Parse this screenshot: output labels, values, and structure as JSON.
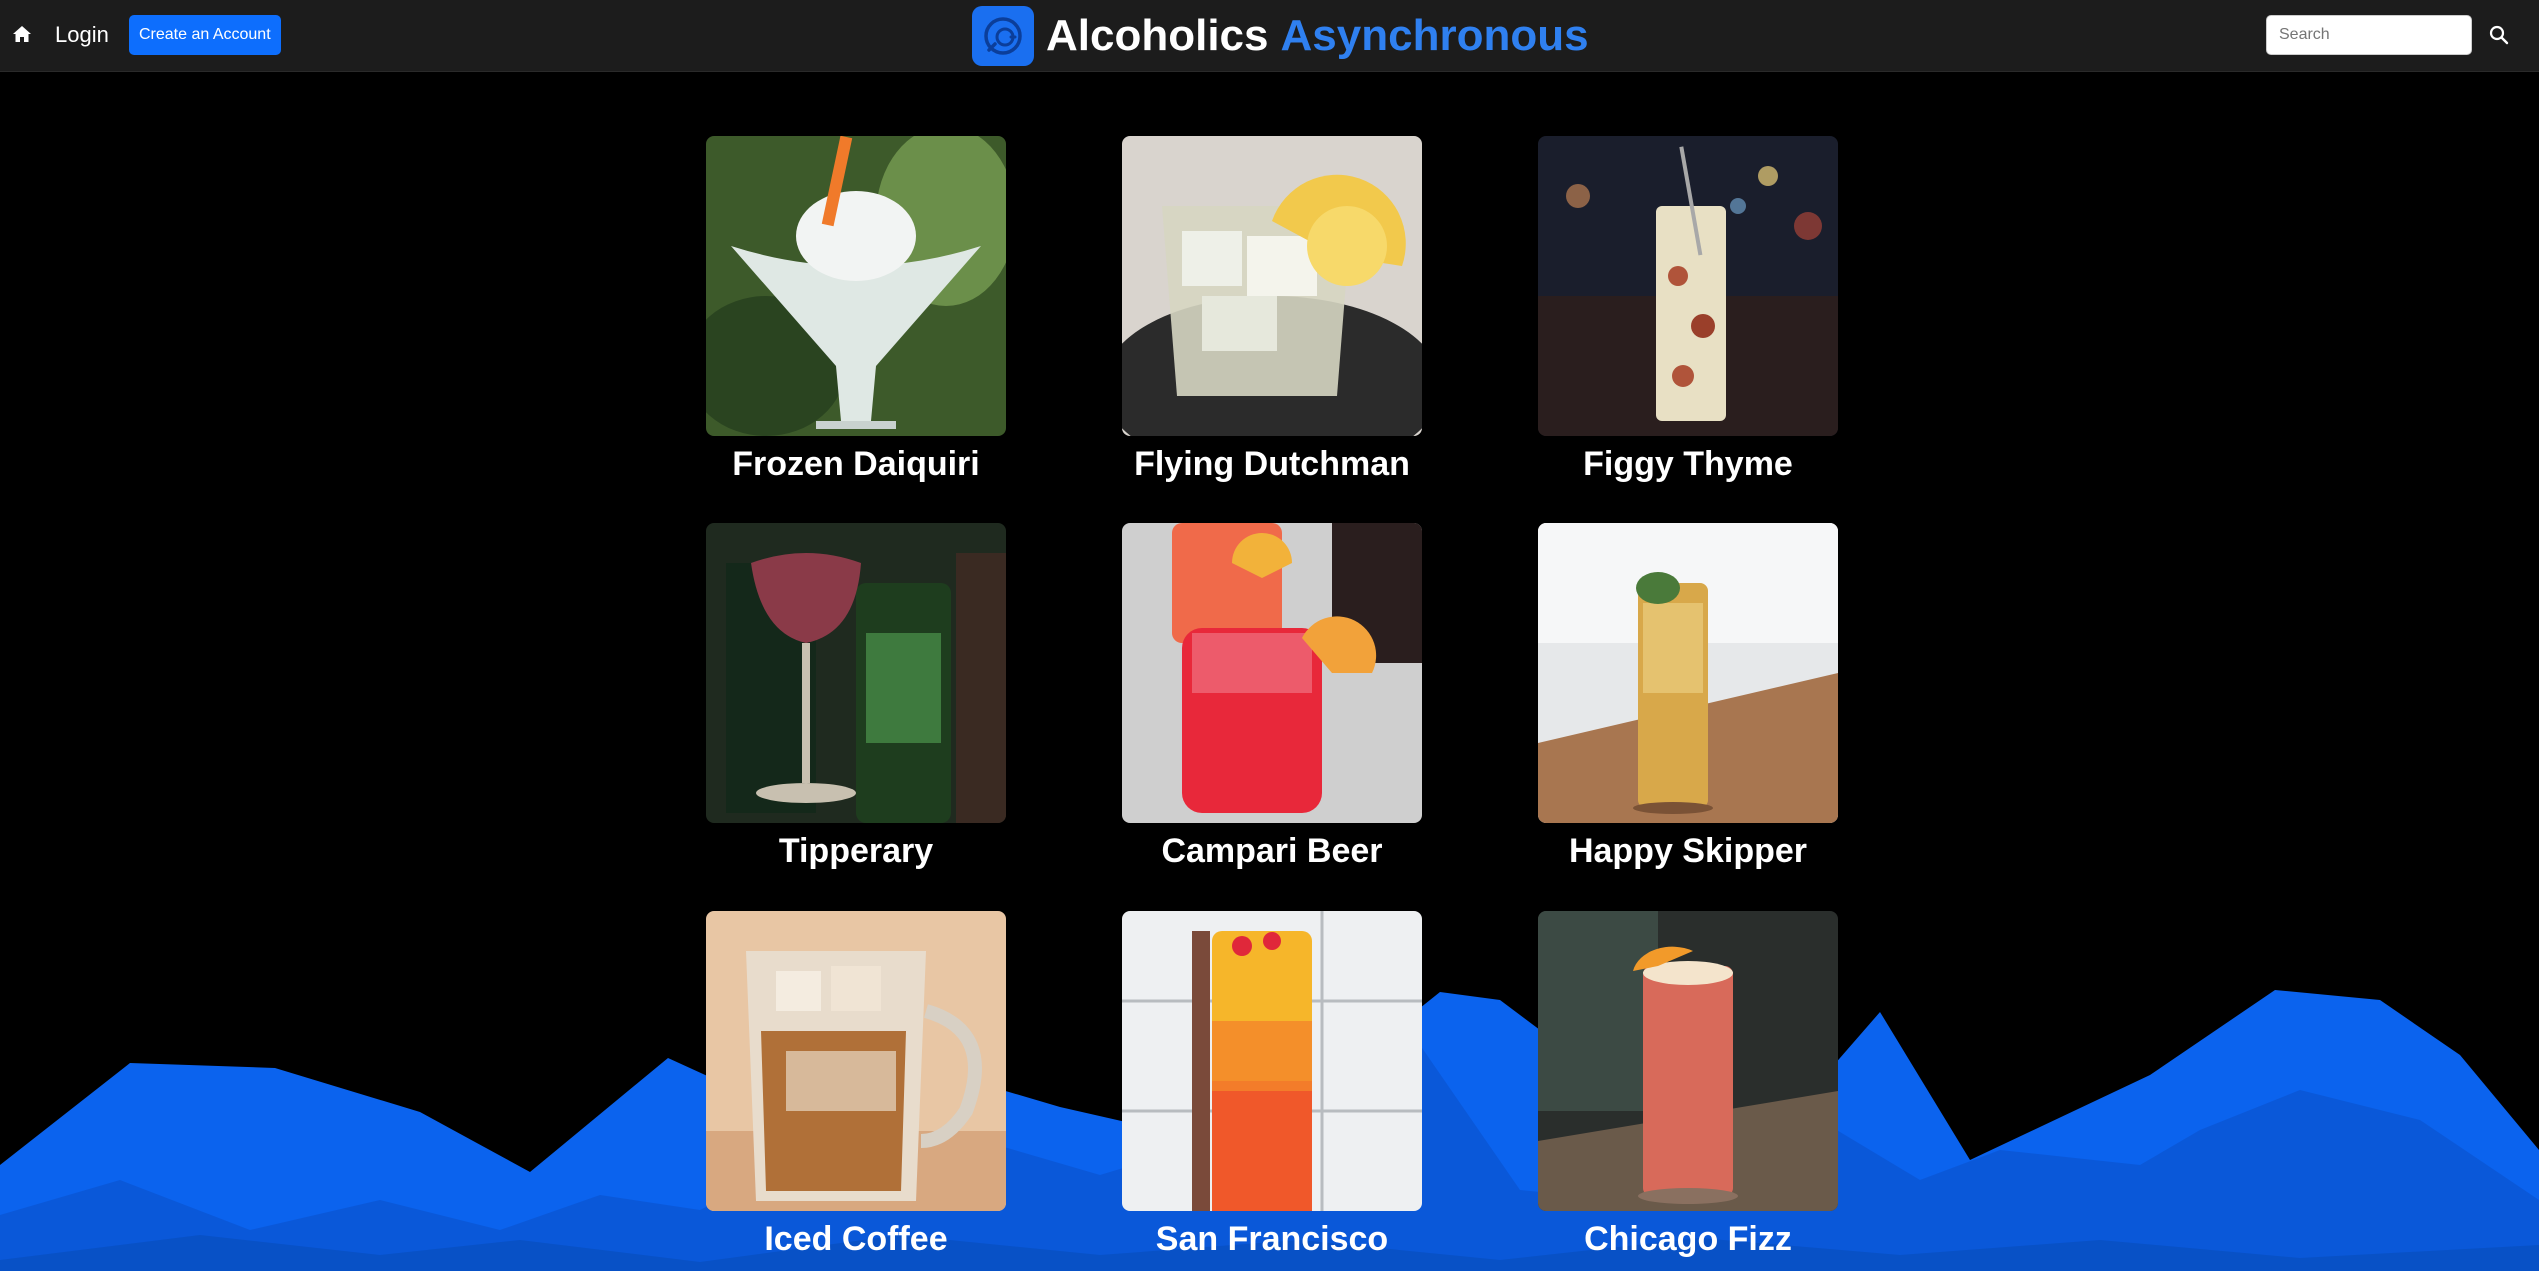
{
  "nav": {
    "home_icon": "home-icon",
    "login_label": "Login",
    "create_account_label": "Create an Account",
    "search_placeholder": "Search",
    "search_icon": "search-icon"
  },
  "brand": {
    "logo_icon": "chat-bubble-icon",
    "word1": "Alcoholics",
    "word2": "Asynchronous",
    "accent_color": "#2f80f0"
  },
  "drinks": [
    {
      "name": "Frozen Daiquiri"
    },
    {
      "name": "Flying Dutchman"
    },
    {
      "name": "Figgy Thyme"
    },
    {
      "name": "Tipperary"
    },
    {
      "name": "Campari Beer"
    },
    {
      "name": "Happy Skipper"
    },
    {
      "name": "Iced Coffee"
    },
    {
      "name": "San Francisco"
    },
    {
      "name": "Chicago Fizz"
    }
  ],
  "colors": {
    "navbar_bg": "#1c1c1c",
    "button_blue": "#0d6efd",
    "mountain_blue": "#0a66f2"
  }
}
